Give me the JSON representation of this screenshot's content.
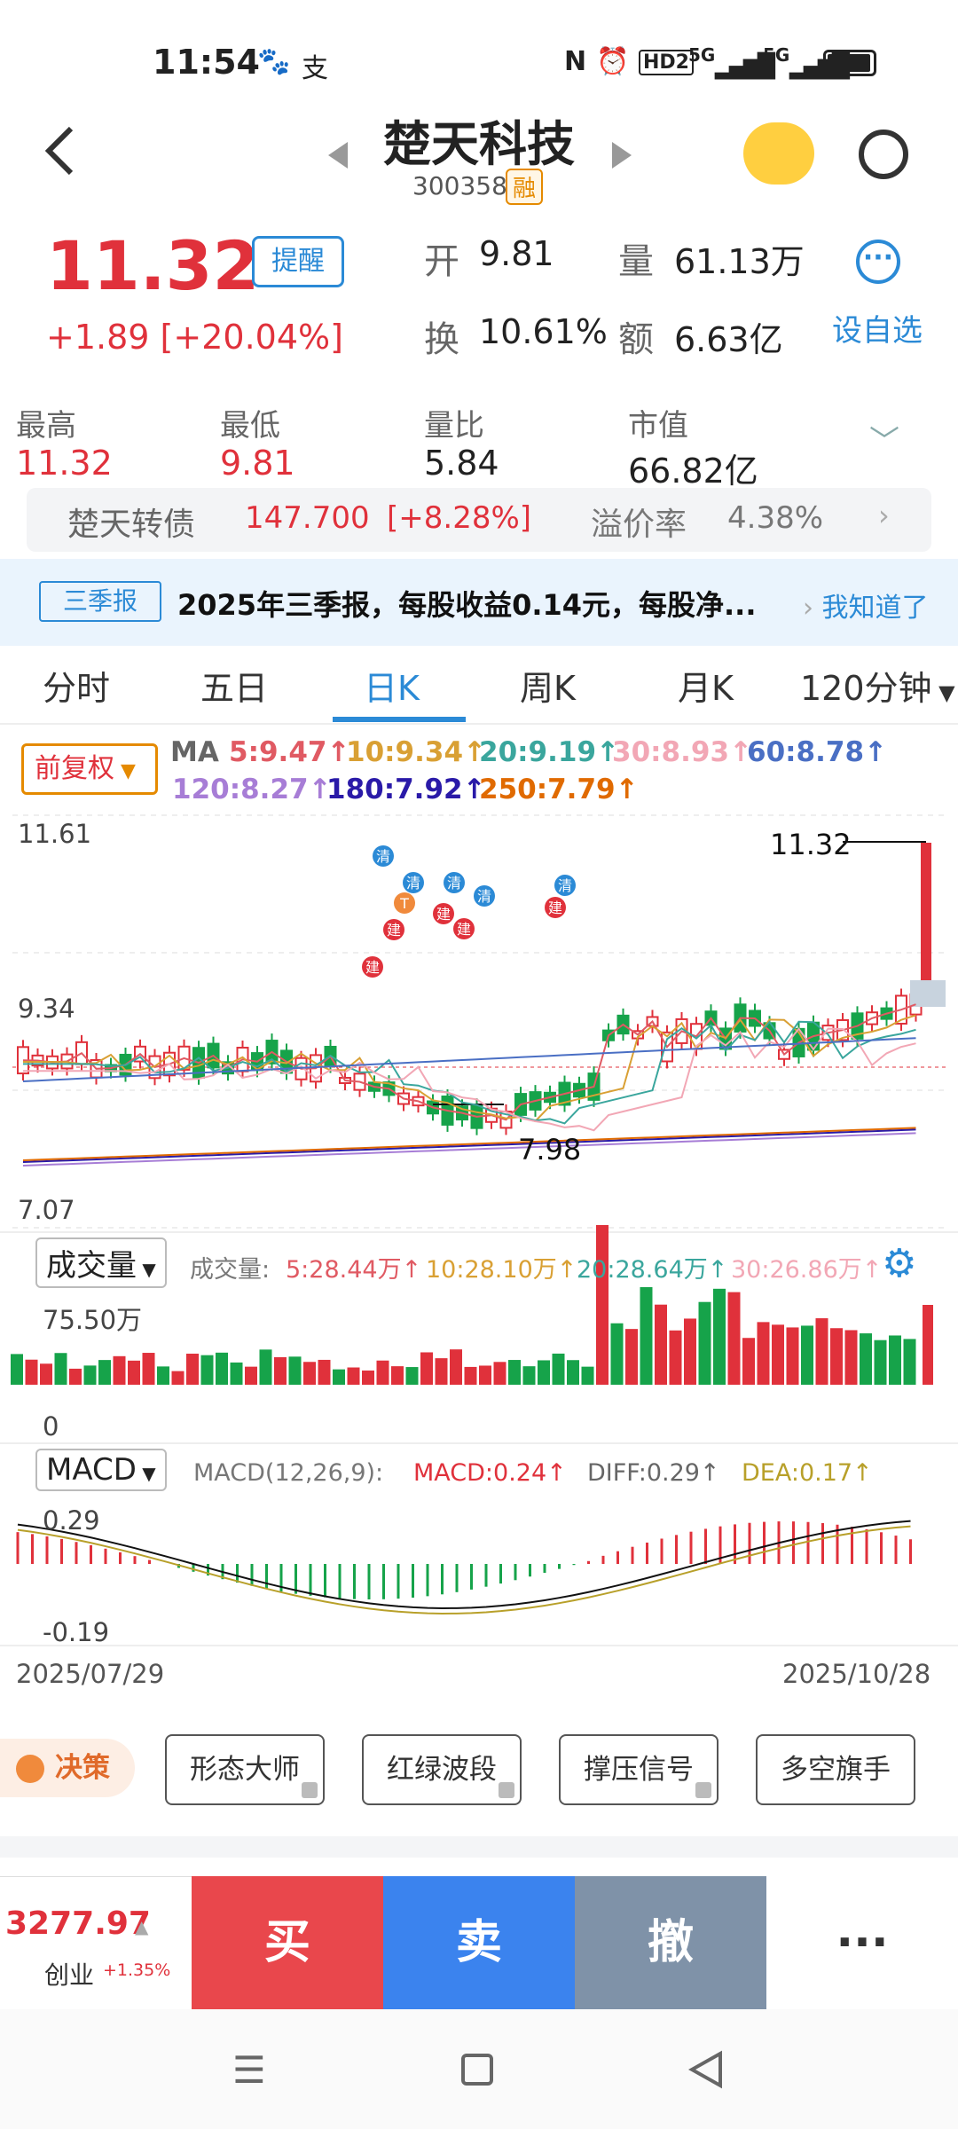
{
  "status": {
    "time": "11:54",
    "icons": [
      "baidu-icon",
      "alipay-icon",
      "nfc-icon",
      "alarm-icon",
      "hd-icon",
      "signal-5g-icon",
      "signal-5g-icon",
      "battery-icon"
    ],
    "net1": "5G",
    "net2": "5G",
    "hd": "HD2"
  },
  "header": {
    "title": "楚天科技",
    "code": "300358",
    "rong": "融"
  },
  "quote": {
    "price": "11.32",
    "remind": "提醒",
    "change": "+1.89",
    "change_pct": "[+20.04%]",
    "open_label": "开",
    "open": "9.81",
    "vol_label": "量",
    "vol": "61.13万",
    "turn_label": "换",
    "turn": "10.61%",
    "amt_label": "额",
    "amt": "6.63亿",
    "add_fav": "设自选",
    "more": "···"
  },
  "stats": [
    {
      "label": "最高",
      "value": "11.32"
    },
    {
      "label": "最低",
      "value": "9.81"
    },
    {
      "label": "量比",
      "value": "5.84"
    },
    {
      "label": "市值",
      "value": "66.82亿"
    }
  ],
  "bond": {
    "name": "楚天转债",
    "price": "147.700",
    "pct": "[+8.28%]",
    "premium_label": "溢价率",
    "premium": "4.38%"
  },
  "notice": {
    "tag": "三季报",
    "text": "2025年三季报，每股收益0.14元，每股净...",
    "action": "我知道了"
  },
  "tabs": [
    "分时",
    "五日",
    "日K",
    "周K",
    "月K",
    "120分钟"
  ],
  "fuquan": "前复权",
  "ma": {
    "prefix": "MA",
    "items": [
      {
        "text": "5:9.47↑",
        "color": "#e05a63"
      },
      {
        "text": "10:9.34↑",
        "color": "#d9a034"
      },
      {
        "text": "20:9.19↑",
        "color": "#3aa69d"
      },
      {
        "text": "30:8.93↑",
        "color": "#f2a7b5"
      },
      {
        "text": "60:8.78↑",
        "color": "#4a6fc4"
      },
      {
        "text": "120:8.27↑",
        "color": "#a77dd6"
      },
      {
        "text": "180:7.92↑",
        "color": "#2a1aa8"
      },
      {
        "text": "250:7.79↑",
        "color": "#e06a00"
      }
    ]
  },
  "chart_data": {
    "type": "candlestick",
    "y_top": "11.61",
    "y_mid": "9.34",
    "y_bottom": "7.07",
    "last_price_label": "11.32",
    "low_label": "7.98",
    "markers": [
      {
        "label": "清",
        "color": "#2b8ad6"
      },
      {
        "label": "T",
        "color": "#f08a3c"
      },
      {
        "label": "建",
        "color": "#e0313b"
      }
    ],
    "volume": {
      "selector": "成交量",
      "prefix": "成交量:",
      "top_label": "75.50万",
      "zero_label": "0",
      "items": [
        {
          "text": "5:28.44万↑",
          "color": "#e05a63"
        },
        {
          "text": "10:28.10万↑",
          "color": "#d9a034"
        },
        {
          "text": "20:28.64万↑",
          "color": "#3aa69d"
        },
        {
          "text": "30:26.86万↑",
          "color": "#f2a7b5"
        }
      ]
    },
    "macd": {
      "selector": "MACD",
      "params": "MACD(12,26,9):",
      "macd": "MACD:0.24↑",
      "diff": "DIFF:0.29↑",
      "dea": "DEA:0.17↑",
      "top": "0.29",
      "bottom": "-0.19"
    },
    "date_start": "2025/07/29",
    "date_end": "2025/10/28"
  },
  "tools": {
    "juece": "决策",
    "items": [
      "形态大师",
      "红绿波段",
      "撑压信号",
      "多空旗手"
    ]
  },
  "trade": {
    "index_value": "3277.97",
    "index_name": "创业",
    "index_pct": "+1.35%",
    "buy": "买",
    "sell": "卖",
    "cancel": "撤",
    "more": "···"
  }
}
